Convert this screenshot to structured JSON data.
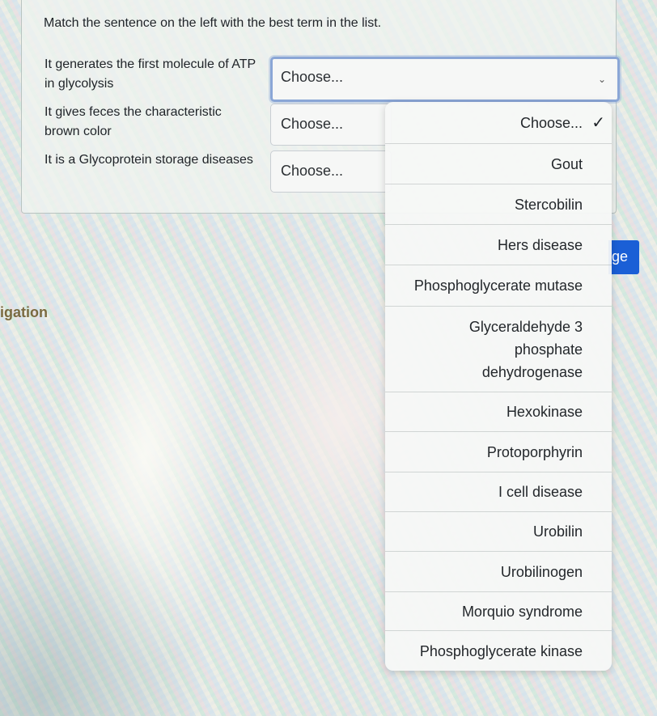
{
  "instruction": "Match the sentence on the left with the best term in the list.",
  "questions": [
    {
      "text": "It generates the first molecule of ATP in glycolysis",
      "selected": "Choose..."
    },
    {
      "text": "It gives feces the characteristic brown color",
      "selected": "Choose..."
    },
    {
      "text": "It is a Glycoprotein storage diseases",
      "selected": "Choose..."
    }
  ],
  "dropdown": {
    "options": [
      "Choose...",
      "Gout",
      "Stercobilin",
      "Hers disease",
      "Phosphoglycerate mutase",
      "Glyceraldehyde 3\nphosphate\ndehydrogenase",
      "Hexokinase",
      "Protoporphyrin",
      "I cell disease",
      "Urobilin",
      "Urobilinogen",
      "Morquio syndrome",
      "Phosphoglycerate kinase"
    ],
    "checked_index": 0,
    "check_glyph": "✓"
  },
  "side_button_label": "ge",
  "side_link_label": "igation",
  "icons": {
    "select_chevron": "chevron-down-icon",
    "selected_check": "checkmark-icon"
  },
  "colors": {
    "focus_border": "#8aa6d6",
    "side_button": "#1a5fd6",
    "side_link": "#7a6a40"
  }
}
